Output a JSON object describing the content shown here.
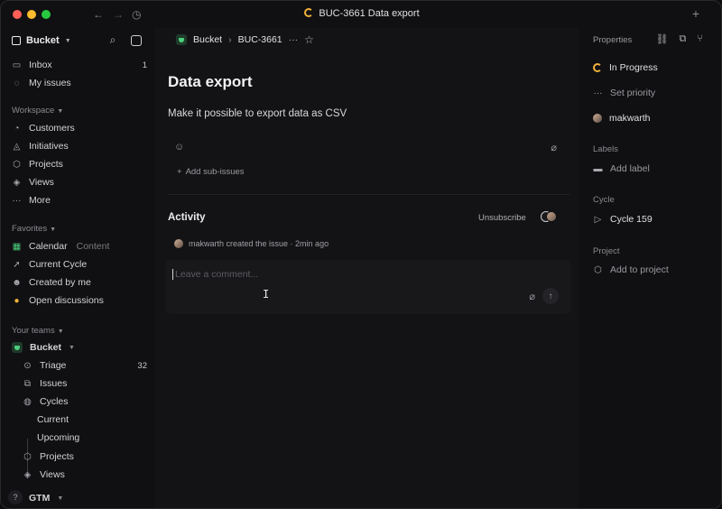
{
  "window": {
    "title": "BUC-3661 Data export",
    "status_color": "#f0b23a"
  },
  "sidebar": {
    "workspace_name": "Bucket",
    "inbox": {
      "label": "Inbox",
      "count": "1"
    },
    "my_issues": "My issues",
    "workspace_section": "Workspace",
    "workspace_items": [
      {
        "label": "Customers",
        "icon": "customers-icon"
      },
      {
        "label": "Initiatives",
        "icon": "initiatives-icon"
      },
      {
        "label": "Projects",
        "icon": "projects-icon"
      },
      {
        "label": "Views",
        "icon": "views-icon"
      },
      {
        "label": "More",
        "icon": "more-icon"
      }
    ],
    "favorites_section": "Favorites",
    "favorites": [
      {
        "label": "Calendar",
        "tag": "Content",
        "icon": "calendar-icon"
      },
      {
        "label": "Current Cycle",
        "icon": "rocket-icon"
      },
      {
        "label": "Created by me",
        "icon": "smile-icon"
      },
      {
        "label": "Open discussions",
        "icon": "emoji-icon"
      }
    ],
    "teams_section": "Your teams",
    "team": {
      "name": "Bucket",
      "items": [
        {
          "label": "Triage",
          "count": "32"
        },
        {
          "label": "Issues"
        },
        {
          "label": "Cycles"
        },
        {
          "label": "Current"
        },
        {
          "label": "Upcoming"
        },
        {
          "label": "Projects"
        },
        {
          "label": "Views"
        }
      ]
    },
    "next_team": "GTM",
    "help": "?"
  },
  "main": {
    "breadcrumb": {
      "team": "Bucket",
      "issue_id": "BUC-3661"
    },
    "title": "Data export",
    "description": "Make it possible to export data as CSV",
    "add_sub_issues": "Add sub-issues",
    "activity": {
      "title": "Activity",
      "unsubscribe": "Unsubscribe",
      "entry": "makwarth created the issue · 2min ago"
    },
    "comment": {
      "placeholder": "Leave a comment..."
    }
  },
  "properties": {
    "header": "Properties",
    "status": "In Progress",
    "priority": "Set priority",
    "assignee": "makwarth",
    "labels_section": "Labels",
    "add_label": "Add label",
    "cycle_section": "Cycle",
    "cycle": "Cycle 159",
    "project_section": "Project",
    "add_project": "Add to project"
  }
}
